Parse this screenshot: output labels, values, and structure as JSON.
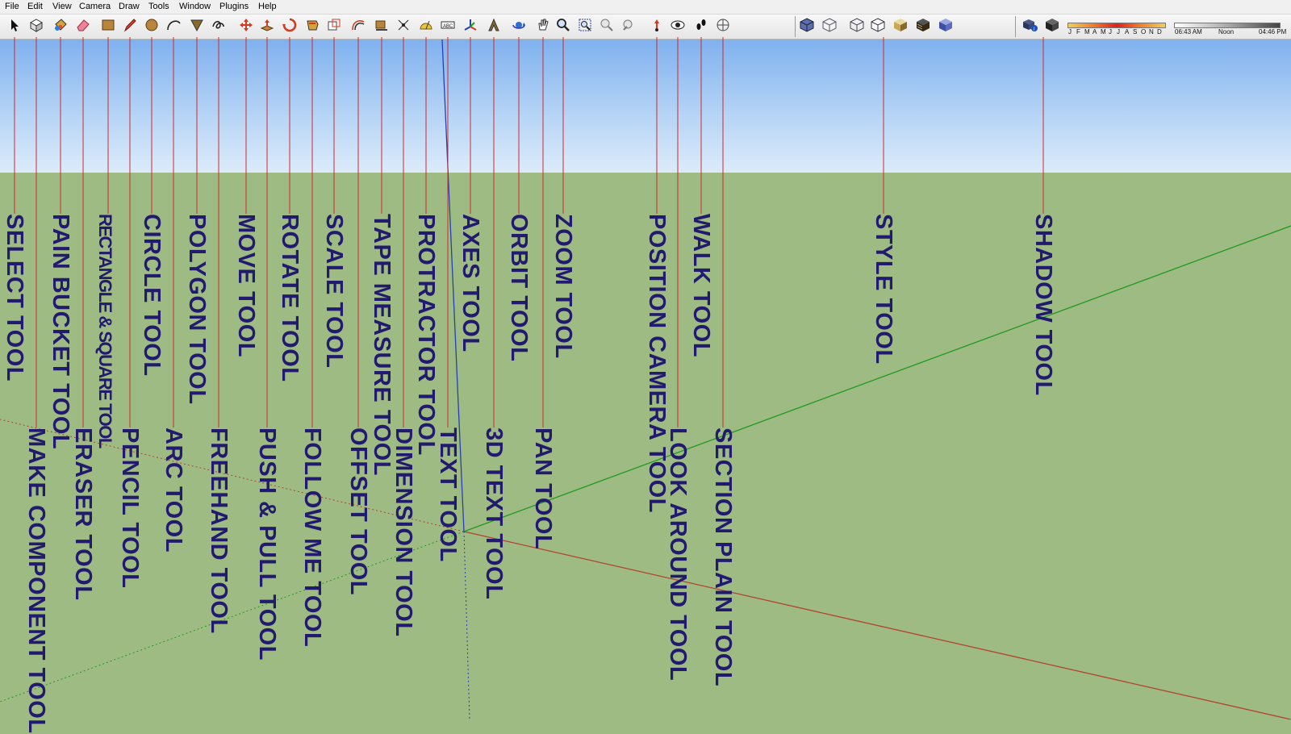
{
  "menu": [
    "File",
    "Edit",
    "View",
    "Camera",
    "Draw",
    "Tools",
    "Window",
    "Plugins",
    "Help"
  ],
  "tools": [
    {
      "name": "select",
      "label": "SELECT TOOL",
      "icon": "arrow-cursor-icon"
    },
    {
      "name": "make-component",
      "label": "MAKE COMPONENT TOOL",
      "icon": "component-cube-icon"
    },
    {
      "name": "paint-bucket",
      "label": "PAIN BUCKET TOOL",
      "icon": "paint-bucket-icon"
    },
    {
      "name": "eraser",
      "label": "ERASER TOOL",
      "icon": "eraser-icon"
    },
    {
      "name": "rectangle",
      "label": "RECTANGLE & SQUARE TOOL",
      "icon": "rectangle-icon"
    },
    {
      "name": "pencil",
      "label": "PENCIL TOOL",
      "icon": "pencil-icon"
    },
    {
      "name": "circle",
      "label": "CIRCLE TOOL",
      "icon": "circle-icon"
    },
    {
      "name": "arc",
      "label": "ARC TOOL",
      "icon": "arc-icon"
    },
    {
      "name": "polygon",
      "label": "POLYGON TOOL",
      "icon": "polygon-icon"
    },
    {
      "name": "freehand",
      "label": "FREEHAND TOOL",
      "icon": "freehand-icon"
    },
    {
      "name": "move",
      "label": "MOVE TOOL",
      "icon": "move-arrows-icon"
    },
    {
      "name": "push-pull",
      "label": "PUSH & PULL TOOL",
      "icon": "push-pull-icon"
    },
    {
      "name": "rotate",
      "label": "ROTATE TOOL",
      "icon": "rotate-icon"
    },
    {
      "name": "follow-me",
      "label": "FOLLOW ME TOOL",
      "icon": "follow-me-icon"
    },
    {
      "name": "scale",
      "label": "SCALE TOOL",
      "icon": "scale-icon"
    },
    {
      "name": "offset",
      "label": "OFFSET TOOL",
      "icon": "offset-icon"
    },
    {
      "name": "tape-measure",
      "label": "TAPE MEASURE TOOL",
      "icon": "tape-measure-icon"
    },
    {
      "name": "dimension",
      "label": "DIMENSION TOOL",
      "icon": "dimension-icon"
    },
    {
      "name": "protractor",
      "label": "PROTRACTOR TOOL",
      "icon": "protractor-icon"
    },
    {
      "name": "text",
      "label": "TEXT TOOL",
      "icon": "text-icon"
    },
    {
      "name": "axes",
      "label": "AXES TOOL",
      "icon": "axes-icon"
    },
    {
      "name": "3d-text",
      "label": "3D TEXT TOOL",
      "icon": "3d-text-icon"
    },
    {
      "name": "orbit",
      "label": "ORBIT TOOL",
      "icon": "orbit-icon"
    },
    {
      "name": "pan",
      "label": "PAN TOOL",
      "icon": "pan-hand-icon"
    },
    {
      "name": "zoom",
      "label": "ZOOM TOOL",
      "icon": "zoom-magnifier-icon"
    },
    {
      "name": "zoom-window",
      "label": "",
      "icon": "zoom-window-icon"
    },
    {
      "name": "previous",
      "label": "",
      "icon": "previous-view-icon"
    },
    {
      "name": "next",
      "label": "",
      "icon": "next-view-icon"
    },
    {
      "name": "position-camera",
      "label": "POSITION CAMERA TOOL",
      "icon": "position-camera-icon"
    },
    {
      "name": "look-around",
      "label": "LOOK AROUND TOOL",
      "icon": "eye-icon"
    },
    {
      "name": "walk",
      "label": "WALK TOOL",
      "icon": "footprints-icon"
    },
    {
      "name": "section-plane",
      "label": "SECTION PLAIN TOOL",
      "icon": "section-plane-icon"
    },
    {
      "name": "style",
      "label": "STYLE TOOL",
      "icon": "style-box-icon"
    },
    {
      "name": "shadow",
      "label": "SHADOW TOOL",
      "icon": "shadow-box-icon"
    }
  ],
  "shadow_settings": {
    "months": [
      "J",
      "F",
      "M",
      "A",
      "M",
      "J",
      "J",
      "A",
      "S",
      "O",
      "N",
      "D"
    ],
    "time_start": "06:43 AM",
    "time_mid": "Noon",
    "time_end": "04:46 PM"
  },
  "colors": {
    "label": "#221a6e",
    "leader": "#cc2b2b",
    "axis_red": "#c0392b",
    "axis_green": "#1f9a1f",
    "axis_blue": "#2a3fb0"
  }
}
